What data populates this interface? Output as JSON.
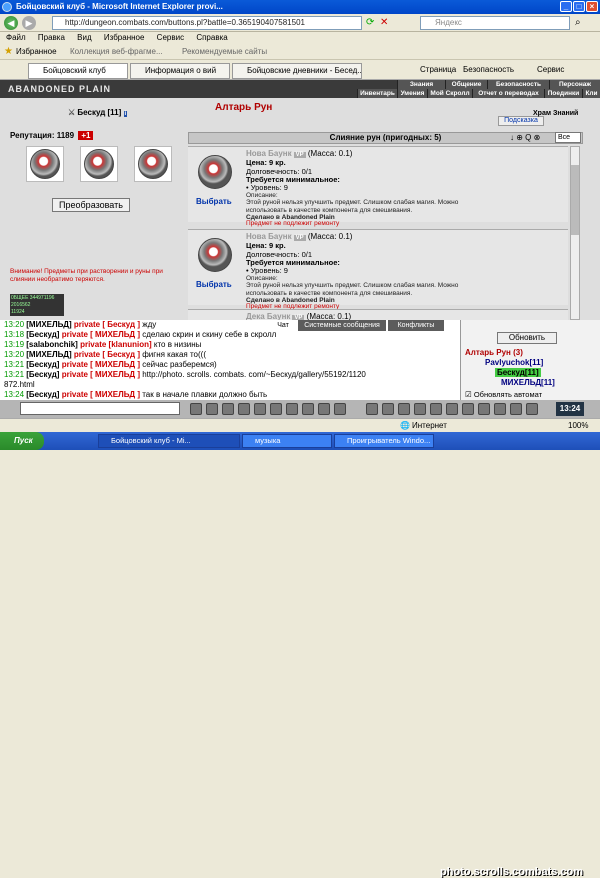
{
  "window": {
    "title": "Бойцовский клуб - Microsoft Internet Explorer provi..."
  },
  "address": {
    "url": "http://dungeon.combats.com/buttons.pl?battle=0.365190407581501",
    "search_placeholder": "Яндекс"
  },
  "menu": [
    "Файл",
    "Правка",
    "Вид",
    "Избранное",
    "Сервис",
    "Справка"
  ],
  "favbar": {
    "favorites": "Избранное",
    "collection": "Коллекция веб-фрагме...",
    "recommended": "Рекомендуемые сайты"
  },
  "tabs": [
    "Бойцовский клуб",
    "Информация о вий",
    "Бойцовские дневники - Бесед..."
  ],
  "ie_tools": {
    "page": "Страница",
    "security": "Безопасность",
    "service": "Сервис"
  },
  "game": {
    "logo": "ABANDONED PLAIN",
    "nav_top": [
      "Знания",
      "Общение",
      "Безопасность",
      "Персонаж"
    ],
    "nav_bottom": [
      "Инвентарь",
      "Умения",
      "Мой Скролл",
      "Отчет о переводах",
      "Поединки",
      "Кли"
    ],
    "hint": "Подсказка",
    "location": "Храм Знаний"
  },
  "altar": {
    "title": "Алтарь Рун",
    "char": "Бескуд [11]",
    "reputation_label": "Репутация: 1189",
    "reputation_badge": "+1",
    "transform": "Преобразовать",
    "note": "Внимание! Предметы при растворении и руны при слиянии необратимо теряются.",
    "merge_header": "Слияние рун (пригодных: 5)",
    "filter": "Все",
    "items": [
      {
        "name": "Нова Баунк",
        "vp": "VP",
        "mass": "(Масса: 0.1)",
        "price": "Цена: 9 кр.",
        "durability": "Долговечность: 0/1",
        "required": "Требуется минимальное:",
        "level": "• Уровень: 9",
        "desc_title": "Описание:",
        "desc": "Этой руной нельзя улучшить предмет. Слишком слабая магия. Можно использовать в качестве компонента для смешивания.",
        "made": "Сделано в Abandoned Plain",
        "repair": "Предмет не подлежит ремонту",
        "pick": "Выбрать"
      },
      {
        "name": "Нова Баунк",
        "vp": "VP",
        "mass": "(Масса: 0.1)",
        "price": "Цена: 9 кр.",
        "durability": "Долговечность: 0/1",
        "required": "Требуется минимальное:",
        "level": "• Уровень: 9",
        "desc_title": "Описание:",
        "desc": "Этой руной нельзя улучшить предмет. Слишком слабая магия. Можно использовать в качестве компонента для смешивания.",
        "made": "Сделано в Abandoned Plain",
        "repair": "Предмет не подлежит ремонту",
        "pick": "Выбрать"
      },
      {
        "name": "Дека Баунк",
        "vp": "VP",
        "mass": "(Масса: 0.1)"
      }
    ],
    "counter": [
      "0БЩЕЕ 344971196",
      "2016562",
      "11924"
    ]
  },
  "chat": {
    "tabs": [
      "Чат",
      "Системные сообщения",
      "Конфликты"
    ],
    "lines": [
      {
        "time": "13:20",
        "nick": "[МИХЕЛЬД]",
        "priv": "private [ Бескуд ]",
        "text": "жду"
      },
      {
        "time": "13:18",
        "nick": "[Бескуд]",
        "priv": "private [ МИХЕЛЬД ]",
        "text": "сделаю скрин и скину себе в скролл"
      },
      {
        "time": "13:19",
        "nick": "[salabonchik]",
        "priv": "private [klanunion]",
        "text": "кто в низины"
      },
      {
        "time": "13:20",
        "nick": "[МИХЕЛЬД]",
        "priv": "private [ Бескуд ]",
        "text": "фигня какая то((("
      },
      {
        "time": "13:21",
        "nick": "[Бескуд]",
        "priv": "private [ МИХЕЛЬД ]",
        "text": "сейчас разберемся)"
      },
      {
        "time": "13:21",
        "nick": "[Бескуд]",
        "priv": "private [ МИХЕЛЬД ]",
        "text": "http://photo. scrolls. combats. com/~Бескуд/gallery/55192/1120"
      },
      {
        "time": "",
        "nick": "",
        "priv": "",
        "text": "872.html"
      },
      {
        "time": "13:24",
        "nick": "[Бескуд]",
        "priv": "private [ МИХЕЛЬД ]",
        "text": "так в начале плавки должно быть"
      }
    ]
  },
  "room": {
    "refresh": "Обновить",
    "title": "Алтарь Рун (3)",
    "users": [
      "Pavlyuchok[11]",
      "Бескуд[11]",
      "МИХЕЛЬД[11]"
    ],
    "autorefresh": "Обновлять автомат",
    "clock": "13:24"
  },
  "status": {
    "text": "Интернет",
    "zoom": "100%"
  },
  "taskbar": {
    "start": "Пуск",
    "tasks": [
      "Бойцовский клуб - Mi...",
      "музыка",
      "Проигрыватель Windo..."
    ],
    "watermark": "photo.scrolls.combats.com"
  },
  "colors": {
    "accent": "#b00000",
    "chat_time": "#009900",
    "private": "#cc0000"
  }
}
